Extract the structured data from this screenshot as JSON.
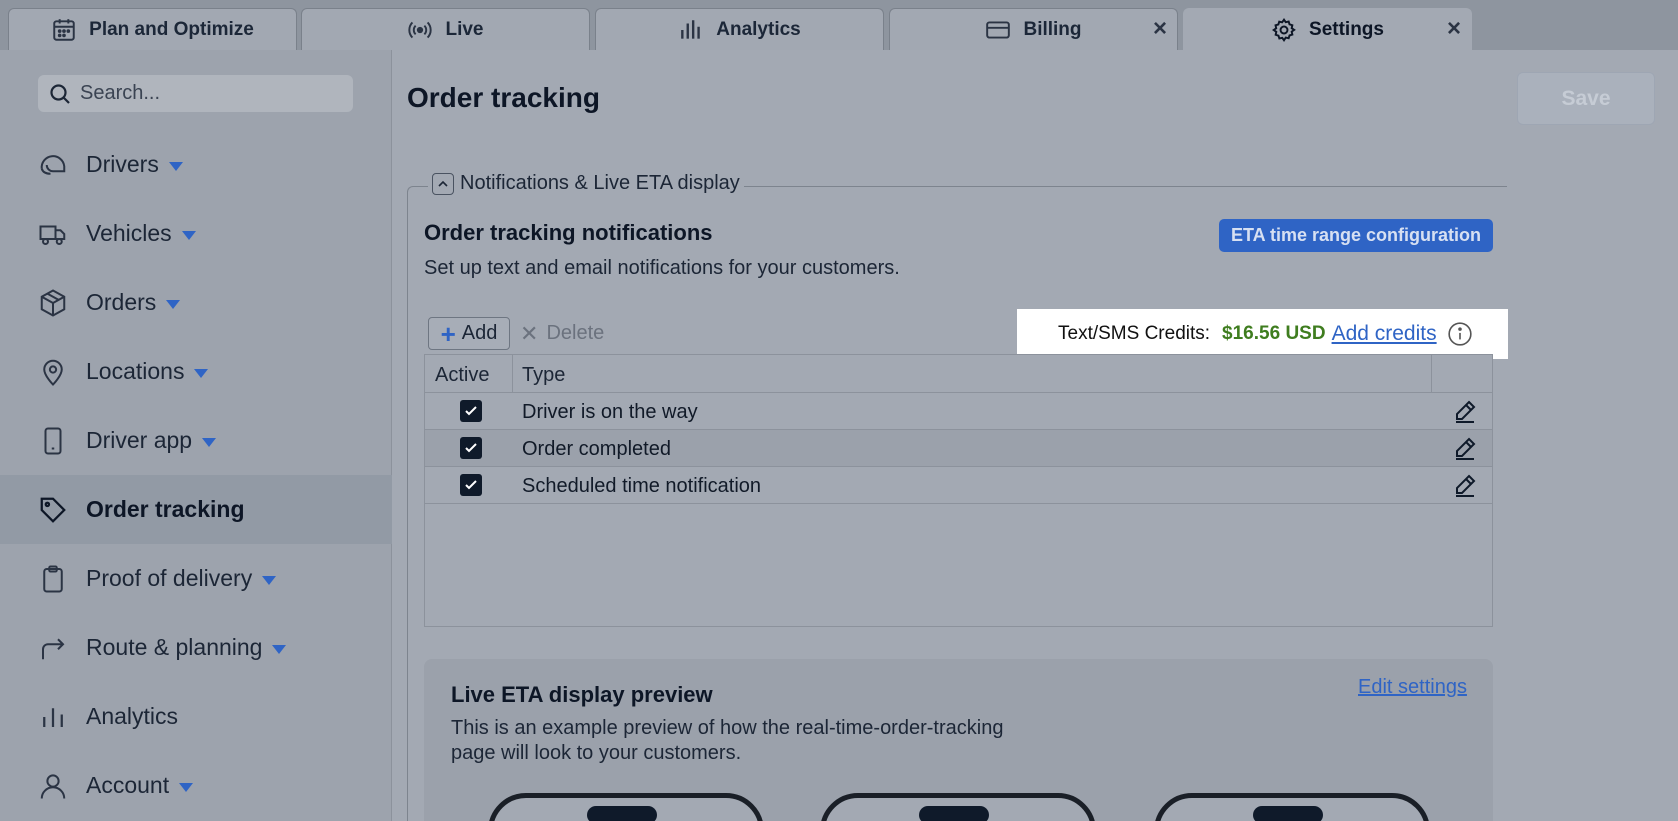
{
  "tabs": [
    {
      "label": "Plan and Optimize",
      "icon": "calendar-icon",
      "closable": false
    },
    {
      "label": "Live",
      "icon": "broadcast-icon",
      "closable": false
    },
    {
      "label": "Analytics",
      "icon": "bar-chart-icon",
      "closable": false
    },
    {
      "label": "Billing",
      "icon": "credit-card-icon",
      "closable": true
    },
    {
      "label": "Settings",
      "icon": "gear-icon",
      "closable": true,
      "active": true
    }
  ],
  "sidebar": {
    "search_placeholder": "Search...",
    "items": [
      {
        "label": "Drivers",
        "icon": "helmet-icon",
        "has_dropdown": true
      },
      {
        "label": "Vehicles",
        "icon": "truck-icon",
        "has_dropdown": true
      },
      {
        "label": "Orders",
        "icon": "package-icon",
        "has_dropdown": true
      },
      {
        "label": "Locations",
        "icon": "map-pin-icon",
        "has_dropdown": true
      },
      {
        "label": "Driver app",
        "icon": "phone-icon",
        "has_dropdown": true
      },
      {
        "label": "Order tracking",
        "icon": "tag-icon",
        "has_dropdown": false,
        "active": true
      },
      {
        "label": "Proof of delivery",
        "icon": "clipboard-icon",
        "has_dropdown": true
      },
      {
        "label": "Route & planning",
        "icon": "route-arrow-icon",
        "has_dropdown": true
      },
      {
        "label": "Analytics",
        "icon": "bar-chart-icon",
        "has_dropdown": false
      },
      {
        "label": "Account",
        "icon": "user-icon",
        "has_dropdown": true
      }
    ]
  },
  "main": {
    "title": "Order tracking",
    "save_label": "Save",
    "fieldset_legend": "Notifications & Live ETA display",
    "section_title": "Order tracking notifications",
    "section_desc": "Set up text and email notifications for your customers.",
    "eta_button": "ETA time range configuration",
    "add_label": "Add",
    "delete_label": "Delete",
    "credits": {
      "label": "Text/SMS Credits:",
      "amount": "$16.56 USD",
      "link": "Add credits"
    },
    "table": {
      "headers": [
        "Active",
        "Type"
      ],
      "rows": [
        {
          "active": true,
          "type": "Driver is on the way"
        },
        {
          "active": true,
          "type": "Order completed"
        },
        {
          "active": true,
          "type": "Scheduled time notification"
        }
      ]
    },
    "preview": {
      "title": "Live ETA display preview",
      "desc": "This is an example preview of how the real-time-order-tracking page will look to your customers.",
      "edit_link": "Edit settings"
    }
  },
  "colors": {
    "accent": "#2f64c5",
    "credit_amount": "#3f7d1f"
  }
}
